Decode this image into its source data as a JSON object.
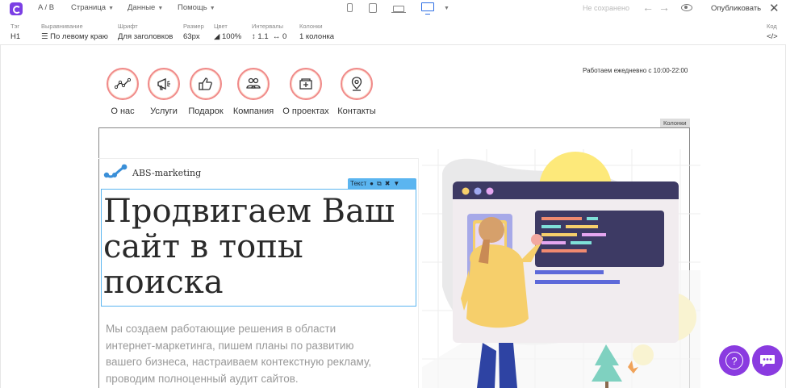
{
  "topbar": {
    "ab_label": "A / B",
    "menu_page": "Страница",
    "menu_data": "Данные",
    "menu_help": "Помощь",
    "status": "Не сохранено",
    "publish_label": "Опубликовать"
  },
  "props": {
    "tag_label": "Тэг",
    "tag_value": "H1",
    "align_label": "Выравнивание",
    "align_value": "По левому краю",
    "font_label": "Шрифт",
    "font_value": "Для заголовков",
    "size_label": "Размер",
    "size_value": "63px",
    "color_label": "Цвет",
    "color_value": "100%",
    "spacing_label": "Интервалы",
    "line_height_value": "1.1",
    "letter_spacing_value": "0",
    "columns_label": "Колонки",
    "columns_value": "1 колонка",
    "code_label": "Код",
    "code_symbol": "</>"
  },
  "nav": {
    "items": [
      {
        "label": "О нас",
        "icon": "chart-line-icon"
      },
      {
        "label": "Услуги",
        "icon": "megaphone-icon"
      },
      {
        "label": "Подарок",
        "icon": "thumbs-up-icon"
      },
      {
        "label": "Компания",
        "icon": "team-icon"
      },
      {
        "label": "О проектах",
        "icon": "projects-icon"
      },
      {
        "label": "Контакты",
        "icon": "location-pin-icon"
      }
    ]
  },
  "header": {
    "hours": "Работаем ежедневно с 10:00-22:00"
  },
  "block": {
    "columns_tag": "Колонки",
    "brand_name": "ABS-marketing",
    "text_toolbar_label": "Текст",
    "headline": "Продвигаем Ваш сайт в топы поиска",
    "description": "Мы создаем работающие решения в области интернет-маркетинга, пишем планы по развитию вашего бизнеса, настраиваем контекстную рекламу, проводим полноценный аудит сайтов."
  },
  "colors": {
    "accent": "#7b3fe4",
    "selection": "#5bb5f0",
    "nav_ring": "#f08a8a",
    "float_buttons": "#8a3be0"
  }
}
